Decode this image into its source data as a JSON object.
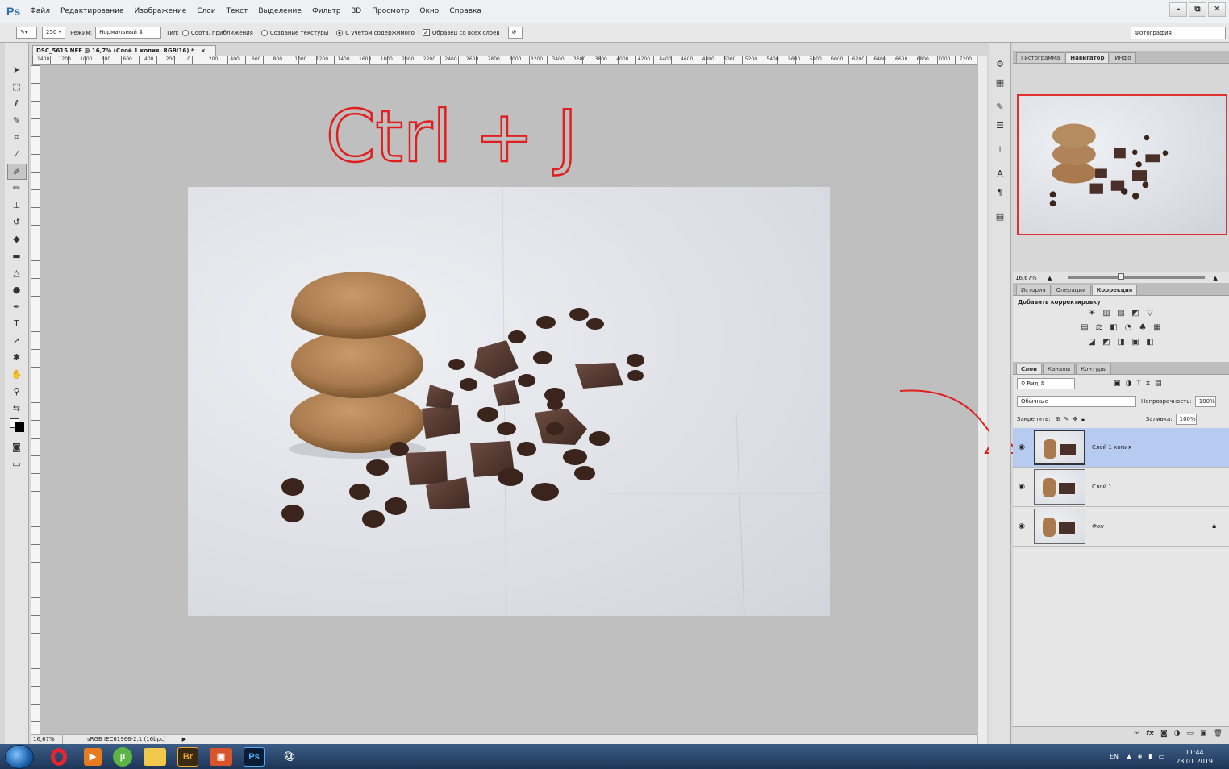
{
  "app": {
    "logo": "Ps"
  },
  "menu": [
    "Файл",
    "Редактирование",
    "Изображение",
    "Слои",
    "Текст",
    "Выделение",
    "Фильтр",
    "3D",
    "Просмотр",
    "Окно",
    "Справка"
  ],
  "window_controls": {
    "minimize": "–",
    "restore": "⧉",
    "close": "✕"
  },
  "options": {
    "brush_size": "250",
    "mode_label": "Режим:",
    "mode_value": "Нормальный",
    "type_label": "Тип:",
    "type_options": [
      "Соотв. приближения",
      "Создание текстуры",
      "С учетом содержимого"
    ],
    "type_selected_index": 2,
    "sample_all_label": "Образец со всех слоев",
    "sample_all_checked": true,
    "workspace": "Фотография"
  },
  "document": {
    "tab_title": "DSC_5615.NEF @ 16,7% (Слой 1 копия, RGB/16) *",
    "tab_close": "×",
    "ruler_labels": [
      "1400",
      "1200",
      "1000",
      "800",
      "600",
      "400",
      "200",
      "0",
      "200",
      "400",
      "600",
      "800",
      "1000",
      "1200",
      "1400",
      "1600",
      "1800",
      "2000",
      "2200",
      "2400",
      "2600",
      "2800",
      "3000",
      "3200",
      "3400",
      "3600",
      "3800",
      "4000",
      "4200",
      "4400",
      "4600",
      "4800",
      "5000",
      "5200",
      "5400",
      "5600",
      "5800",
      "6000",
      "6200",
      "6400",
      "6600",
      "6800",
      "7000",
      "7200"
    ],
    "annotation_text": "Ctrl + J"
  },
  "status": {
    "zoom": "16,67%",
    "profile": "sRGB IEC61966-2.1 (16bpc)"
  },
  "navigator": {
    "tabs": [
      "Гистограмма",
      "Навигатор",
      "Инфо"
    ],
    "active_tab": 1,
    "zoom": "16,67%"
  },
  "adjustments": {
    "tabs": [
      "История",
      "Операции",
      "Коррекция"
    ],
    "active_tab": 2,
    "title": "Добавить корректировку"
  },
  "layers": {
    "tabs": [
      "Слои",
      "Каналы",
      "Контуры"
    ],
    "active_tab": 0,
    "filter": "Вид",
    "blend_mode": "Обычные",
    "opacity_label": "Непрозрачность:",
    "opacity": "100%",
    "lock_label": "Закрепить:",
    "fill_label": "Заливка:",
    "fill": "100%",
    "items": [
      {
        "name": "Слой 1 копия",
        "selected": true,
        "locked": false
      },
      {
        "name": "Слой 1",
        "selected": false,
        "locked": false
      },
      {
        "name": "Фон",
        "selected": false,
        "locked": true
      }
    ]
  },
  "taskbar": {
    "apps": [
      "Opera",
      "Media",
      "uTorrent",
      "Explorer",
      "Br",
      "Presentation",
      "Ps",
      "Paint"
    ],
    "lang": "EN",
    "time": "11:44",
    "date": "28.01.2019"
  },
  "colors": {
    "annotation": "#e02020",
    "layer_selected": "#b7cbf1",
    "ps_blue": "#2b6fb3"
  }
}
